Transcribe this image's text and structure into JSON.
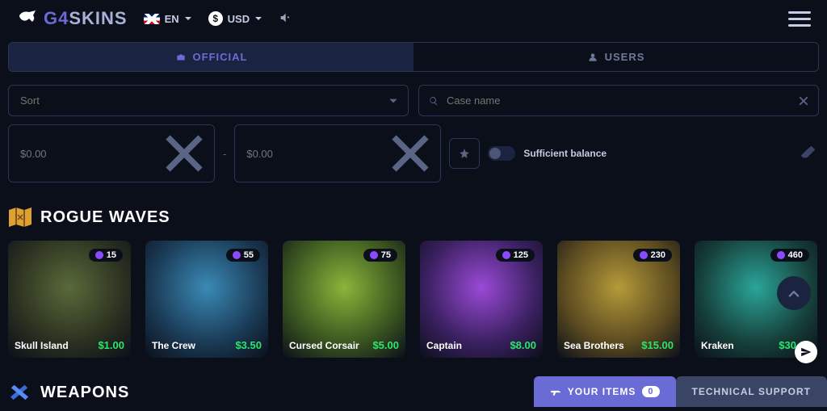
{
  "header": {
    "lang": "EN",
    "currency": "USD"
  },
  "tabs": {
    "official": "OFFICIAL",
    "users": "USERS"
  },
  "filters": {
    "sort_placeholder": "Sort",
    "search_placeholder": "Case name",
    "price_placeholder": "$0.00",
    "dash": "-",
    "sufficient": "Sufficient balance"
  },
  "sections": {
    "rogue": {
      "title": "ROGUE WAVES"
    },
    "weapons": {
      "title": "WEAPONS"
    }
  },
  "cases": [
    {
      "name": "Skull Island",
      "price": "$1.00",
      "badge": "15"
    },
    {
      "name": "The Crew",
      "price": "$3.50",
      "badge": "55"
    },
    {
      "name": "Cursed Corsair",
      "price": "$5.00",
      "badge": "75"
    },
    {
      "name": "Captain",
      "price": "$8.00",
      "badge": "125"
    },
    {
      "name": "Sea Brothers",
      "price": "$15.00",
      "badge": "230"
    },
    {
      "name": "Kraken",
      "price": "$30.00",
      "badge": "460"
    }
  ],
  "footer": {
    "your_items": "YOUR ITEMS",
    "items_count": "0",
    "support": "TECHNICAL SUPPORT"
  },
  "brand": {
    "g4": "G4",
    "rest": "SKINS"
  },
  "icons": {
    "logo": "panther-icon",
    "flag": "uk-flag-icon",
    "chev": "chevron-down-icon",
    "mute": "volume-mute-icon",
    "burger": "hamburger-icon",
    "official": "briefcase-icon",
    "users": "users-icon",
    "search": "search-icon",
    "close": "close-icon",
    "star": "star-icon",
    "eraser": "eraser-icon",
    "map": "map-icon",
    "weapons": "crossed-guns-icon",
    "up": "chevron-up-icon",
    "gun": "gun-icon",
    "send": "paper-plane-icon",
    "gem": "gem-icon"
  }
}
